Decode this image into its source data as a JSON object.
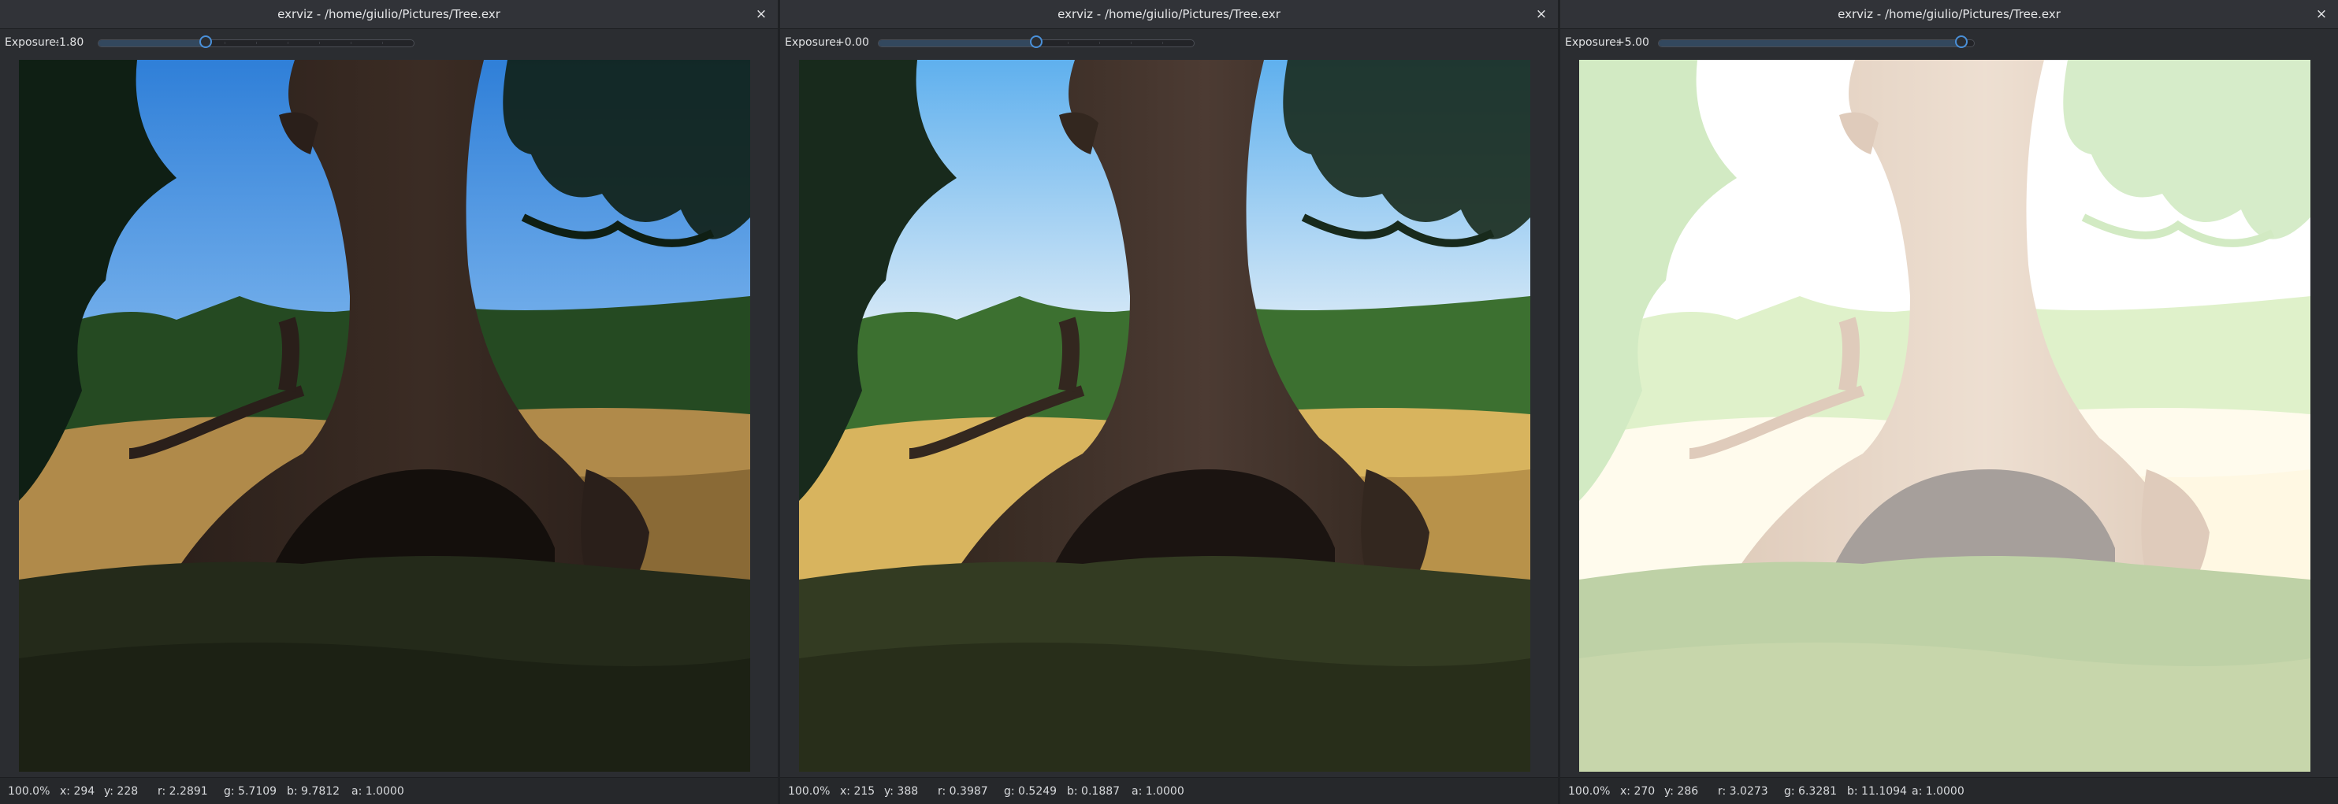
{
  "windows": [
    {
      "title": "exrviz - /home/giulio/Pictures/Tree.exr",
      "exposure_label": "Exposure:",
      "exposure_value": "-1.80",
      "exposure_fraction": 0.34,
      "image_alt": "Tree",
      "status": {
        "zoom": "100.0%",
        "x": "x: 294",
        "y": "y: 228",
        "r": "r: 2.2891",
        "g": "g: 5.7109",
        "b": "b: 9.7812",
        "a": "a: 1.0000"
      }
    },
    {
      "title": "exrviz - /home/giulio/Pictures/Tree.exr",
      "exposure_label": "Exposure:",
      "exposure_value": "+0.00",
      "exposure_fraction": 0.5,
      "image_alt": "Tree",
      "status": {
        "zoom": "100.0%",
        "x": "x: 215",
        "y": "y: 388",
        "r": "r: 0.3987",
        "g": "g: 0.5249",
        "b": "b: 0.1887",
        "a": "a: 1.0000"
      }
    },
    {
      "title": "exrviz - /home/giulio/Pictures/Tree.exr",
      "exposure_label": "Exposure:",
      "exposure_value": "+5.00",
      "exposure_fraction": 0.96,
      "image_alt": "Tree",
      "status": {
        "zoom": "100.0%",
        "x": "x: 270",
        "y": "y: 286",
        "r": "r: 3.0273",
        "g": "g: 6.3281",
        "b": "b: 11.1094",
        "a": "a: 1.0000"
      }
    }
  ],
  "close_glyph": "×",
  "colors": {
    "accent": "#4a90d9",
    "window_bg": "#2b2d31",
    "titlebar_bg": "#313338"
  }
}
